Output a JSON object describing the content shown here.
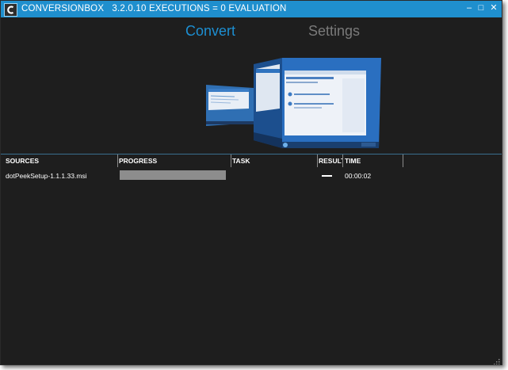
{
  "window": {
    "app_name": "CONVERSIONBOX",
    "title_detail": "3.2.0.10 EXECUTIONS = 0 EVALUATION",
    "controls": {
      "minimize": "–",
      "maximize": "□",
      "close": "✕"
    },
    "accent_color": "#1f8fce"
  },
  "tabs": [
    {
      "label": "Convert",
      "active": true
    },
    {
      "label": "Settings",
      "active": false
    }
  ],
  "grid": {
    "columns": [
      "SOURCES",
      "PROGRESS",
      "TASK",
      "RESULT",
      "TIME"
    ],
    "rows": [
      {
        "source": "dotPeekSetup-1.1.1.33.msi",
        "progress_fraction": 1.0,
        "task": "",
        "result": "—",
        "time": "00:00:02"
      }
    ]
  }
}
